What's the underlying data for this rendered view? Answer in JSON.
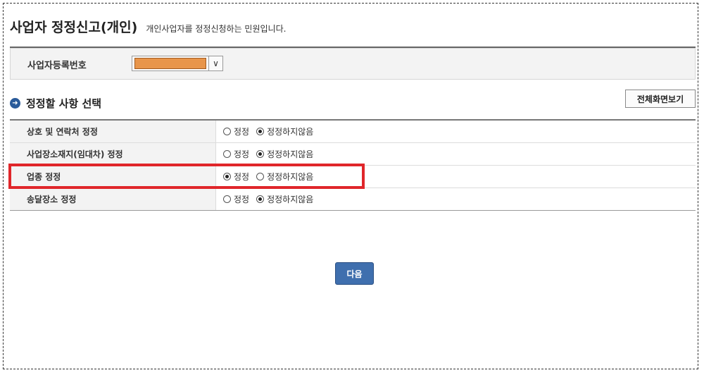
{
  "header": {
    "title": "사업자 정정신고(개인)",
    "subtitle": "개인사업자를 정정신청하는 민원입니다."
  },
  "registration": {
    "label": "사업자등록번호",
    "value_masked": true
  },
  "section": {
    "title": "정정할 사항 선택",
    "fullscreen_button": "전체화면보기"
  },
  "options": {
    "yes": "정정",
    "no": "정정하지않음"
  },
  "rows": [
    {
      "label": "상호 및 연락처 정정",
      "selected": "no"
    },
    {
      "label": "사업장소재지(임대차) 정정",
      "selected": "no"
    },
    {
      "label": "업종 정정",
      "selected": "yes"
    },
    {
      "label": "송달장소 정정",
      "selected": "no"
    }
  ],
  "next_button": "다음",
  "colors": {
    "accent": "#3f6fae",
    "highlight": "#e0262a",
    "mask": "#e8954a"
  }
}
